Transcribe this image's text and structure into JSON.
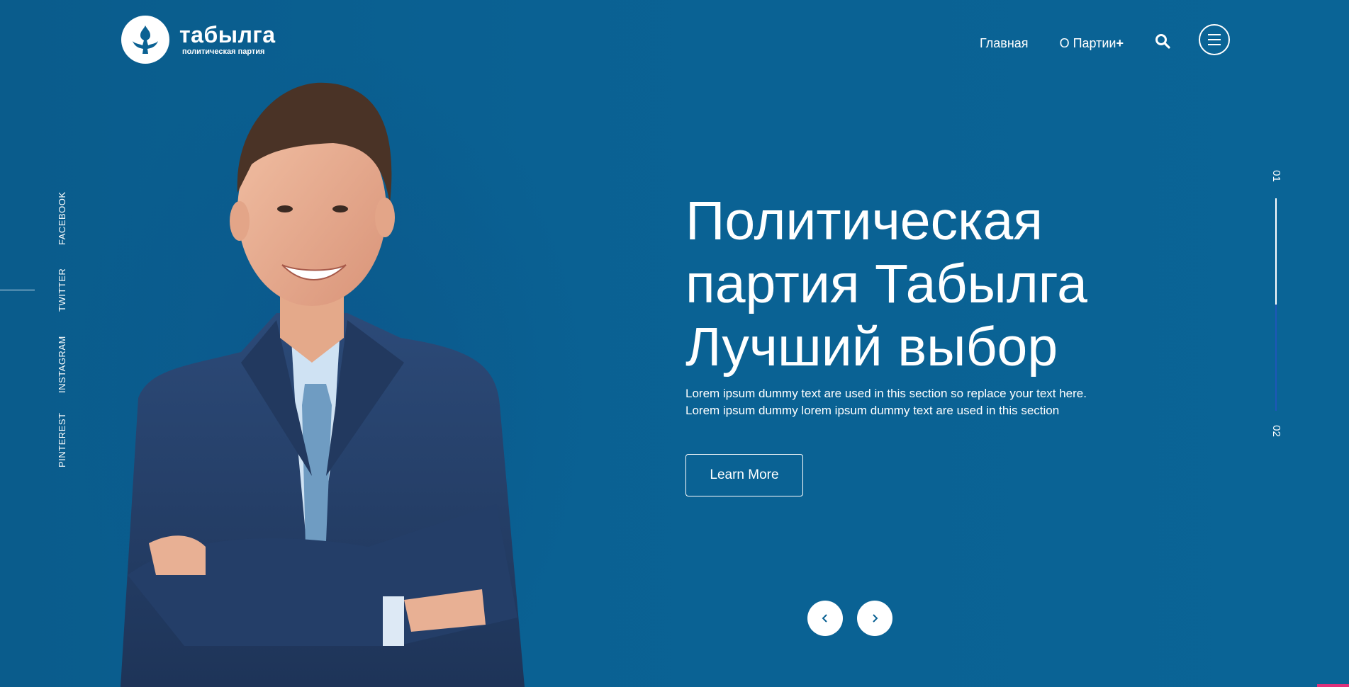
{
  "header": {
    "logo_name": "табылга",
    "logo_subtitle": "политическая партия",
    "nav": [
      {
        "label": "Главная"
      },
      {
        "label": "О Партии",
        "suffix": "+"
      }
    ],
    "search_icon": "search-icon",
    "menu_icon": "hamburger-menu-icon"
  },
  "social": {
    "links": [
      "FACEBOOK",
      "TWITTER",
      "INSTAGRAM",
      "PINTEREST"
    ]
  },
  "hero": {
    "title_line1": "Политическая",
    "title_line2": "партия Табылга",
    "title_line3": "Лучший выбор",
    "desc_line1": "Lorem ipsum dummy text are used in this section so replace your text here.",
    "desc_line2": "Lorem ipsum dummy lorem ipsum dummy text are used in this section",
    "button_label": "Learn More"
  },
  "slider": {
    "current": "01",
    "next": "02",
    "prev_icon": "chevron-left-icon",
    "next_icon": "chevron-right-icon"
  },
  "colors": {
    "background": "#0a6193",
    "text": "#ffffff",
    "indicator_inactive": "#1f56b8",
    "accent": "#e0307a"
  }
}
